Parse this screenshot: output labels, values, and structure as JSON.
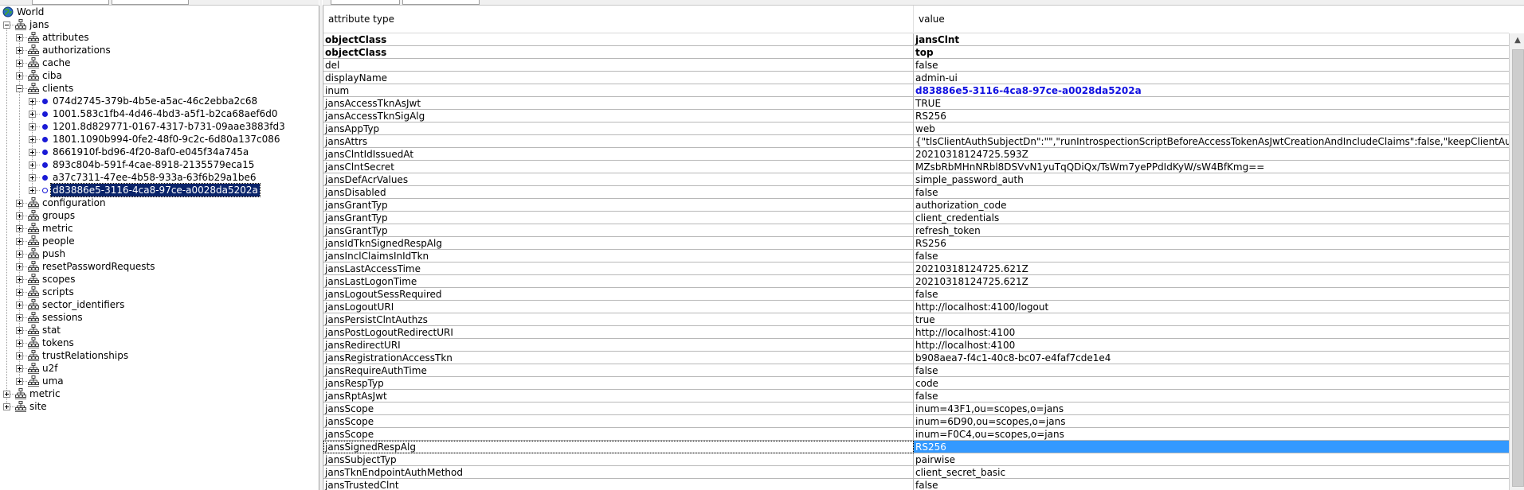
{
  "tree": {
    "root_label": "World",
    "nodes": [
      {
        "label": "jans",
        "level": 1,
        "expander": "minus",
        "icon": "tree-node-icon",
        "selected": false
      },
      {
        "label": "attributes",
        "level": 2,
        "expander": "plus",
        "icon": "tree-node-icon"
      },
      {
        "label": "authorizations",
        "level": 2,
        "expander": "plus",
        "icon": "tree-node-icon"
      },
      {
        "label": "cache",
        "level": 2,
        "expander": "plus",
        "icon": "tree-node-icon"
      },
      {
        "label": "ciba",
        "level": 2,
        "expander": "plus",
        "icon": "tree-node-icon"
      },
      {
        "label": "clients",
        "level": 2,
        "expander": "minus",
        "icon": "tree-node-icon"
      },
      {
        "label": "074d2745-379b-4b5e-a5ac-46c2ebba2c68",
        "level": 3,
        "expander": "plus",
        "icon": "bullet-icon"
      },
      {
        "label": "1001.583c1fb4-4d46-4bd3-a5f1-b2ca68aef6d0",
        "level": 3,
        "expander": "plus",
        "icon": "bullet-icon"
      },
      {
        "label": "1201.8d829771-0167-4317-b731-09aae3883fd3",
        "level": 3,
        "expander": "plus",
        "icon": "bullet-icon"
      },
      {
        "label": "1801.1090b994-0fe2-48f0-9c2c-6d80a137c086",
        "level": 3,
        "expander": "plus",
        "icon": "bullet-icon"
      },
      {
        "label": "8661910f-bd96-4f20-8af0-e045f34a745a",
        "level": 3,
        "expander": "plus",
        "icon": "bullet-icon"
      },
      {
        "label": "893c804b-591f-4cae-8918-2135579eca15",
        "level": 3,
        "expander": "plus",
        "icon": "bullet-icon"
      },
      {
        "label": "a37c7311-47ee-4b58-933a-63f6b29a1be6",
        "level": 3,
        "expander": "plus",
        "icon": "bullet-icon"
      },
      {
        "label": "d83886e5-3116-4ca8-97ce-a0028da5202a",
        "level": 3,
        "expander": "plus",
        "icon": "bullet-open-icon",
        "selected": true
      },
      {
        "label": "configuration",
        "level": 2,
        "expander": "plus",
        "icon": "tree-node-icon"
      },
      {
        "label": "groups",
        "level": 2,
        "expander": "plus",
        "icon": "tree-node-icon"
      },
      {
        "label": "metric",
        "level": 2,
        "expander": "plus",
        "icon": "tree-node-icon"
      },
      {
        "label": "people",
        "level": 2,
        "expander": "plus",
        "icon": "tree-node-icon"
      },
      {
        "label": "push",
        "level": 2,
        "expander": "plus",
        "icon": "tree-node-icon"
      },
      {
        "label": "resetPasswordRequests",
        "level": 2,
        "expander": "plus",
        "icon": "tree-node-icon"
      },
      {
        "label": "scopes",
        "level": 2,
        "expander": "plus",
        "icon": "tree-node-icon"
      },
      {
        "label": "scripts",
        "level": 2,
        "expander": "plus",
        "icon": "tree-node-icon"
      },
      {
        "label": "sector_identifiers",
        "level": 2,
        "expander": "plus",
        "icon": "tree-node-icon"
      },
      {
        "label": "sessions",
        "level": 2,
        "expander": "plus",
        "icon": "tree-node-icon"
      },
      {
        "label": "stat",
        "level": 2,
        "expander": "plus",
        "icon": "tree-node-icon"
      },
      {
        "label": "tokens",
        "level": 2,
        "expander": "plus",
        "icon": "tree-node-icon"
      },
      {
        "label": "trustRelationships",
        "level": 2,
        "expander": "plus",
        "icon": "tree-node-icon"
      },
      {
        "label": "u2f",
        "level": 2,
        "expander": "plus",
        "icon": "tree-node-icon"
      },
      {
        "label": "uma",
        "level": 2,
        "expander": "plus",
        "icon": "tree-node-icon"
      },
      {
        "label": "metric",
        "level": 1,
        "expander": "plus",
        "icon": "tree-node-icon"
      },
      {
        "label": "site",
        "level": 1,
        "expander": "plus",
        "icon": "tree-node-icon"
      }
    ]
  },
  "table": {
    "headers": {
      "attribute": "attribute type",
      "value": "value"
    },
    "rows": [
      {
        "name": "objectClass",
        "value": "jansClnt",
        "bold": true
      },
      {
        "name": "objectClass",
        "value": "top",
        "bold": true
      },
      {
        "name": "del",
        "value": "false"
      },
      {
        "name": "displayName",
        "value": "admin-ui"
      },
      {
        "name": "inum",
        "value": "d83886e5-3116-4ca8-97ce-a0028da5202a",
        "link": true
      },
      {
        "name": "jansAccessTknAsJwt",
        "value": "TRUE"
      },
      {
        "name": "jansAccessTknSigAlg",
        "value": "RS256"
      },
      {
        "name": "jansAppTyp",
        "value": "web"
      },
      {
        "name": "jansAttrs",
        "value": "{\"tlsClientAuthSubjectDn\":\"\",\"runIntrospectionScriptBeforeAccessTokenAsJwtCreationAndIncludeClaims\":false,\"keepClientAutho..."
      },
      {
        "name": "jansClntIdIssuedAt",
        "value": "20210318124725.593Z"
      },
      {
        "name": "jansClntSecret",
        "value": "MZsbRbMHnNRbl8DSVvN1yuTqQDiQx/TsWm7yePPdIdKyW/sW4BfKmg=="
      },
      {
        "name": "jansDefAcrValues",
        "value": "simple_password_auth"
      },
      {
        "name": "jansDisabled",
        "value": "false"
      },
      {
        "name": "jansGrantTyp",
        "value": "authorization_code"
      },
      {
        "name": "jansGrantTyp",
        "value": "client_credentials"
      },
      {
        "name": "jansGrantTyp",
        "value": "refresh_token"
      },
      {
        "name": "jansIdTknSignedRespAlg",
        "value": "RS256"
      },
      {
        "name": "jansInclClaimsInIdTkn",
        "value": "false"
      },
      {
        "name": "jansLastAccessTime",
        "value": "20210318124725.621Z"
      },
      {
        "name": "jansLastLogonTime",
        "value": "20210318124725.621Z"
      },
      {
        "name": "jansLogoutSessRequired",
        "value": "false"
      },
      {
        "name": "jansLogoutURI",
        "value": "http://localhost:4100/logout"
      },
      {
        "name": "jansPersistClntAuthzs",
        "value": "true"
      },
      {
        "name": "jansPostLogoutRedirectURI",
        "value": "http://localhost:4100"
      },
      {
        "name": "jansRedirectURI",
        "value": "http://localhost:4100"
      },
      {
        "name": "jansRegistrationAccessTkn",
        "value": "b908aea7-f4c1-40c8-bc07-e4faf7cde1e4"
      },
      {
        "name": "jansRequireAuthTime",
        "value": "false"
      },
      {
        "name": "jansRespTyp",
        "value": "code"
      },
      {
        "name": "jansRptAsJwt",
        "value": "false"
      },
      {
        "name": "jansScope",
        "value": "inum=43F1,ou=scopes,o=jans"
      },
      {
        "name": "jansScope",
        "value": "inum=6D90,ou=scopes,o=jans"
      },
      {
        "name": "jansScope",
        "value": "inum=F0C4,ou=scopes,o=jans"
      },
      {
        "name": "jansSignedRespAlg",
        "value": "RS256",
        "selected": true
      },
      {
        "name": "jansSubjectTyp",
        "value": "pairwise"
      },
      {
        "name": "jansTknEndpointAuthMethod",
        "value": "client_secret_basic"
      },
      {
        "name": "jansTrustedClnt",
        "value": "false"
      }
    ]
  },
  "colors": {
    "selection": "#0a246a",
    "row_selection": "#3399ff",
    "link": "#1010e0"
  }
}
